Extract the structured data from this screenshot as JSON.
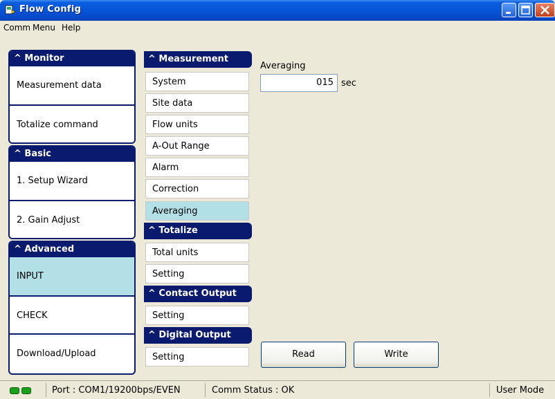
{
  "window": {
    "title": "Flow Config"
  },
  "menu": [
    "Comm",
    "Menu",
    "Help"
  ],
  "left_sections": [
    {
      "header": "Monitor",
      "items": [
        "Measurement data",
        "Totalize command"
      ]
    },
    {
      "header": "Basic",
      "items": [
        "1. Setup Wizard",
        "2. Gain Adjust"
      ]
    },
    {
      "header": "Advanced",
      "items": [
        "INPUT",
        "CHECK",
        "Download/Upload"
      ],
      "selected": "INPUT"
    }
  ],
  "mid_sections": [
    {
      "header": "Measurement",
      "items": [
        "System",
        "Site data",
        "Flow units",
        "A-Out Range",
        "Alarm",
        "Correction",
        "Averaging"
      ]
    },
    {
      "header": "Totalize",
      "items": [
        "Total units",
        "Setting"
      ]
    },
    {
      "header": "Contact Output",
      "items": [
        "Setting"
      ]
    },
    {
      "header": "Digital Output",
      "items": [
        "Setting"
      ]
    }
  ],
  "mid_selected": "Averaging",
  "content": {
    "label": "Averaging",
    "value": "015",
    "unit": "sec"
  },
  "buttons": {
    "read": "Read",
    "write": "Write"
  },
  "status": {
    "port": "Port : COM1/19200bps/EVEN",
    "comm": "Comm Status : OK",
    "mode": "User Mode"
  },
  "colors": {
    "nav_dark": "#0a1a6e",
    "selected": "#b3e0e6",
    "led": "#1aa11a"
  }
}
